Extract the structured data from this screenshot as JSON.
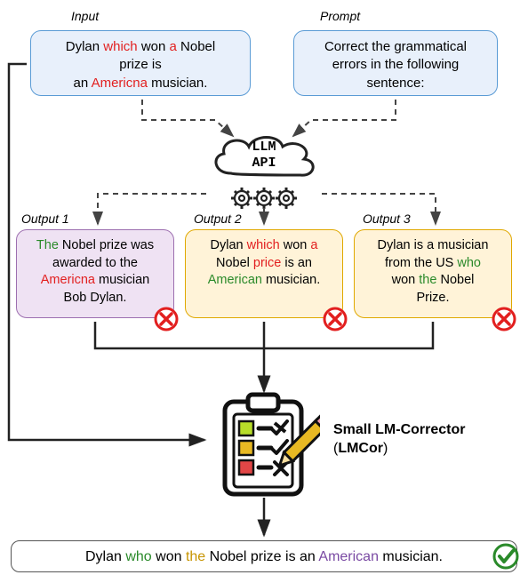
{
  "labels": {
    "input": "Input",
    "prompt": "Prompt",
    "out1": "Output 1",
    "out2": "Output 2",
    "out3": "Output 3"
  },
  "llm": {
    "line1": "LLM",
    "line2": "API"
  },
  "lmcor": {
    "bold": "Small LM-Corrector",
    "paren": "(",
    "name": "LMCor",
    "paren2": ")"
  },
  "input_box": {
    "p1a": "Dylan ",
    "p1b": "which",
    "p1c": " won ",
    "p1d": "a",
    "p1e": " Nobel",
    "p2a": "prize is",
    "p3a": "an ",
    "p3b": "Americna",
    "p3c": " musician."
  },
  "prompt_box": {
    "l1": "Correct the grammatical",
    "l2": "errors in the following",
    "l3": "sentence:"
  },
  "out1_box": {
    "l1a": "The",
    "l1b": " Nobel prize was",
    "l2": "awarded to the",
    "l3a": "Americna",
    "l3b": " musician",
    "l4": "Bob Dylan."
  },
  "out2_box": {
    "l1a": "Dylan ",
    "l1b": "which",
    "l1c": " won ",
    "l1d": "a",
    "l2a": "Nobel ",
    "l2b": "price",
    "l2c": " is an",
    "l3a": "American",
    "l3b": " musician."
  },
  "out3_box": {
    "l1": "Dylan is a musician",
    "l2a": "from the US ",
    "l2b": "who",
    "l3a": "won ",
    "l3b": "the",
    "l3c": " Nobel",
    "l4": "Prize."
  },
  "final_box": {
    "a": "Dylan ",
    "b": "who",
    "c": " won ",
    "d": "the",
    "e": " Nobel prize is an ",
    "f": "American",
    "g": " musician."
  }
}
